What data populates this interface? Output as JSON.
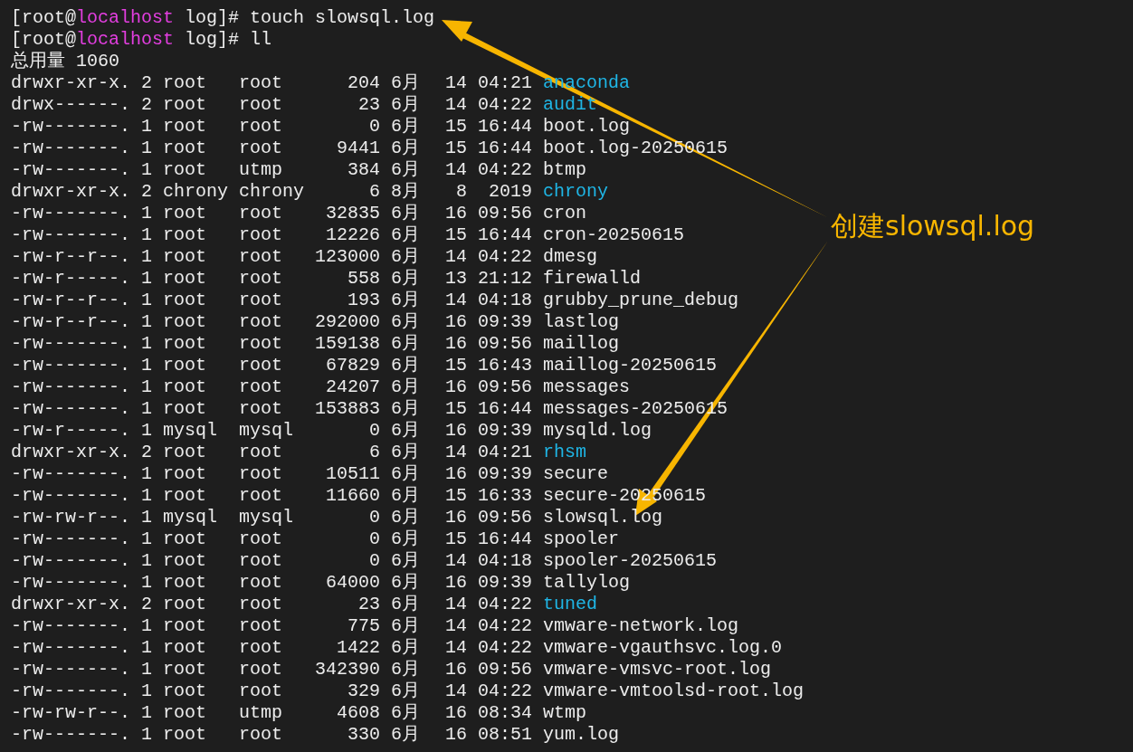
{
  "terminal": {
    "prompts": [
      {
        "prefix": "[root@",
        "host": "localhost",
        "suffix": " log]#",
        "command": "touch slowsql.log"
      },
      {
        "prefix": "[root@",
        "host": "localhost",
        "suffix": " log]#",
        "command": "ll"
      }
    ],
    "total": "总用量 1060",
    "rows": [
      {
        "perms": "drwxr-xr-x.",
        "links": "2",
        "owner": "root",
        "group": "root",
        "size": "204",
        "month": "6月",
        "day": "14",
        "time": "04:21",
        "name": "anaconda",
        "kind": "dir"
      },
      {
        "perms": "drwx------.",
        "links": "2",
        "owner": "root",
        "group": "root",
        "size": "23",
        "month": "6月",
        "day": "14",
        "time": "04:22",
        "name": "audit",
        "kind": "dir"
      },
      {
        "perms": "-rw-------.",
        "links": "1",
        "owner": "root",
        "group": "root",
        "size": "0",
        "month": "6月",
        "day": "15",
        "time": "16:44",
        "name": "boot.log",
        "kind": "file"
      },
      {
        "perms": "-rw-------.",
        "links": "1",
        "owner": "root",
        "group": "root",
        "size": "9441",
        "month": "6月",
        "day": "15",
        "time": "16:44",
        "name": "boot.log-20250615",
        "kind": "file"
      },
      {
        "perms": "-rw-------.",
        "links": "1",
        "owner": "root",
        "group": "utmp",
        "size": "384",
        "month": "6月",
        "day": "14",
        "time": "04:22",
        "name": "btmp",
        "kind": "file"
      },
      {
        "perms": "drwxr-xr-x.",
        "links": "2",
        "owner": "chrony",
        "group": "chrony",
        "size": "6",
        "month": "8月",
        "day": "8",
        "time": "2019",
        "name": "chrony",
        "kind": "dir"
      },
      {
        "perms": "-rw-------.",
        "links": "1",
        "owner": "root",
        "group": "root",
        "size": "32835",
        "month": "6月",
        "day": "16",
        "time": "09:56",
        "name": "cron",
        "kind": "file"
      },
      {
        "perms": "-rw-------.",
        "links": "1",
        "owner": "root",
        "group": "root",
        "size": "12226",
        "month": "6月",
        "day": "15",
        "time": "16:44",
        "name": "cron-20250615",
        "kind": "file"
      },
      {
        "perms": "-rw-r--r--.",
        "links": "1",
        "owner": "root",
        "group": "root",
        "size": "123000",
        "month": "6月",
        "day": "14",
        "time": "04:22",
        "name": "dmesg",
        "kind": "file"
      },
      {
        "perms": "-rw-r-----.",
        "links": "1",
        "owner": "root",
        "group": "root",
        "size": "558",
        "month": "6月",
        "day": "13",
        "time": "21:12",
        "name": "firewalld",
        "kind": "file"
      },
      {
        "perms": "-rw-r--r--.",
        "links": "1",
        "owner": "root",
        "group": "root",
        "size": "193",
        "month": "6月",
        "day": "14",
        "time": "04:18",
        "name": "grubby_prune_debug",
        "kind": "file"
      },
      {
        "perms": "-rw-r--r--.",
        "links": "1",
        "owner": "root",
        "group": "root",
        "size": "292000",
        "month": "6月",
        "day": "16",
        "time": "09:39",
        "name": "lastlog",
        "kind": "file"
      },
      {
        "perms": "-rw-------.",
        "links": "1",
        "owner": "root",
        "group": "root",
        "size": "159138",
        "month": "6月",
        "day": "16",
        "time": "09:56",
        "name": "maillog",
        "kind": "file"
      },
      {
        "perms": "-rw-------.",
        "links": "1",
        "owner": "root",
        "group": "root",
        "size": "67829",
        "month": "6月",
        "day": "15",
        "time": "16:43",
        "name": "maillog-20250615",
        "kind": "file"
      },
      {
        "perms": "-rw-------.",
        "links": "1",
        "owner": "root",
        "group": "root",
        "size": "24207",
        "month": "6月",
        "day": "16",
        "time": "09:56",
        "name": "messages",
        "kind": "file"
      },
      {
        "perms": "-rw-------.",
        "links": "1",
        "owner": "root",
        "group": "root",
        "size": "153883",
        "month": "6月",
        "day": "15",
        "time": "16:44",
        "name": "messages-20250615",
        "kind": "file"
      },
      {
        "perms": "-rw-r-----.",
        "links": "1",
        "owner": "mysql",
        "group": "mysql",
        "size": "0",
        "month": "6月",
        "day": "16",
        "time": "09:39",
        "name": "mysqld.log",
        "kind": "file"
      },
      {
        "perms": "drwxr-xr-x.",
        "links": "2",
        "owner": "root",
        "group": "root",
        "size": "6",
        "month": "6月",
        "day": "14",
        "time": "04:21",
        "name": "rhsm",
        "kind": "dir"
      },
      {
        "perms": "-rw-------.",
        "links": "1",
        "owner": "root",
        "group": "root",
        "size": "10511",
        "month": "6月",
        "day": "16",
        "time": "09:39",
        "name": "secure",
        "kind": "file"
      },
      {
        "perms": "-rw-------.",
        "links": "1",
        "owner": "root",
        "group": "root",
        "size": "11660",
        "month": "6月",
        "day": "15",
        "time": "16:33",
        "name": "secure-20250615",
        "kind": "file"
      },
      {
        "perms": "-rw-rw-r--.",
        "links": "1",
        "owner": "mysql",
        "group": "mysql",
        "size": "0",
        "month": "6月",
        "day": "16",
        "time": "09:56",
        "name": "slowsql.log",
        "kind": "file"
      },
      {
        "perms": "-rw-------.",
        "links": "1",
        "owner": "root",
        "group": "root",
        "size": "0",
        "month": "6月",
        "day": "15",
        "time": "16:44",
        "name": "spooler",
        "kind": "file"
      },
      {
        "perms": "-rw-------.",
        "links": "1",
        "owner": "root",
        "group": "root",
        "size": "0",
        "month": "6月",
        "day": "14",
        "time": "04:18",
        "name": "spooler-20250615",
        "kind": "file"
      },
      {
        "perms": "-rw-------.",
        "links": "1",
        "owner": "root",
        "group": "root",
        "size": "64000",
        "month": "6月",
        "day": "16",
        "time": "09:39",
        "name": "tallylog",
        "kind": "file"
      },
      {
        "perms": "drwxr-xr-x.",
        "links": "2",
        "owner": "root",
        "group": "root",
        "size": "23",
        "month": "6月",
        "day": "14",
        "time": "04:22",
        "name": "tuned",
        "kind": "dir"
      },
      {
        "perms": "-rw-------.",
        "links": "1",
        "owner": "root",
        "group": "root",
        "size": "775",
        "month": "6月",
        "day": "14",
        "time": "04:22",
        "name": "vmware-network.log",
        "kind": "file"
      },
      {
        "perms": "-rw-------.",
        "links": "1",
        "owner": "root",
        "group": "root",
        "size": "1422",
        "month": "6月",
        "day": "14",
        "time": "04:22",
        "name": "vmware-vgauthsvc.log.0",
        "kind": "file"
      },
      {
        "perms": "-rw-------.",
        "links": "1",
        "owner": "root",
        "group": "root",
        "size": "342390",
        "month": "6月",
        "day": "16",
        "time": "09:56",
        "name": "vmware-vmsvc-root.log",
        "kind": "file"
      },
      {
        "perms": "-rw-------.",
        "links": "1",
        "owner": "root",
        "group": "root",
        "size": "329",
        "month": "6月",
        "day": "14",
        "time": "04:22",
        "name": "vmware-vmtoolsd-root.log",
        "kind": "file"
      },
      {
        "perms": "-rw-rw-r--.",
        "links": "1",
        "owner": "root",
        "group": "utmp",
        "size": "4608",
        "month": "6月",
        "day": "16",
        "time": "08:34",
        "name": "wtmp",
        "kind": "file"
      },
      {
        "perms": "-rw-------.",
        "links": "1",
        "owner": "root",
        "group": "root",
        "size": "330",
        "month": "6月",
        "day": "16",
        "time": "08:51",
        "name": "yum.log",
        "kind": "file"
      }
    ]
  },
  "annotation": {
    "label": "创建slowsql.log"
  }
}
